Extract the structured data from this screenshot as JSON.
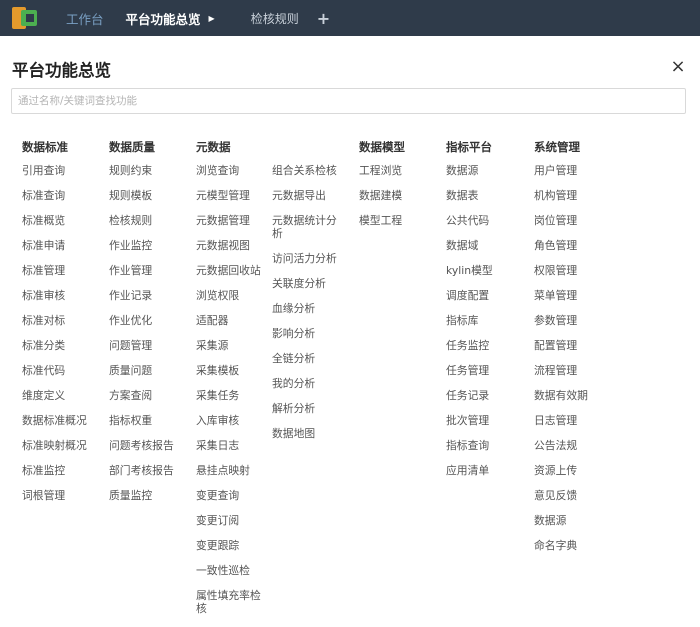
{
  "nav": {
    "home": "工作台",
    "current": "平台功能总览",
    "tab": "检核规则",
    "add": "+"
  },
  "panel": {
    "title": "平台功能总览",
    "close": "×",
    "search_placeholder": "通过名称/关键词查找功能"
  },
  "columns": [
    {
      "header": "数据标准",
      "items": [
        "引用查询",
        "标准查询",
        "标准概览",
        "标准申请",
        "标准管理",
        "标准审核",
        "标准对标",
        "标准分类",
        "标准代码",
        "维度定义",
        "数据标准概况",
        "标准映射概况",
        "标准监控",
        "词根管理"
      ]
    },
    {
      "header": "数据质量",
      "items": [
        "规则约束",
        "规则模板",
        "检核规则",
        "作业监控",
        "作业管理",
        "作业记录",
        "作业优化",
        "问题管理",
        "质量问题",
        "方案查阅",
        "指标权重",
        "问题考核报告",
        "部门考核报告",
        "质量监控"
      ]
    },
    {
      "header": "元数据",
      "items": [
        "浏览查询",
        "元模型管理",
        "元数据管理",
        "元数据视图",
        "元数据回收站",
        "浏览权限",
        "适配器",
        "采集源",
        "采集模板",
        "采集任务",
        "入库审核",
        "采集日志",
        "悬挂点映射",
        "变更查询",
        "变更订阅",
        "变更跟踪",
        "一致性巡检",
        "属性填充率检核"
      ]
    },
    {
      "header": "",
      "items": [
        "组合关系检核",
        "元数据导出",
        "元数据统计分析",
        "访问活力分析",
        "关联度分析",
        "血缘分析",
        "影响分析",
        "全链分析",
        "我的分析",
        "解析分析",
        "数据地图"
      ]
    },
    {
      "header": "数据模型",
      "items": [
        "工程浏览",
        "数据建模",
        "模型工程"
      ]
    },
    {
      "header": "指标平台",
      "items": [
        "数据源",
        "数据表",
        "公共代码",
        "数据域",
        "kylin模型",
        "调度配置",
        "指标库",
        "任务监控",
        "任务管理",
        "任务记录",
        "批次管理",
        "指标查询",
        "应用清单"
      ]
    },
    {
      "header": "系统管理",
      "items": [
        "用户管理",
        "机构管理",
        "岗位管理",
        "角色管理",
        "权限管理",
        "菜单管理",
        "参数管理",
        "配置管理",
        "流程管理",
        "数据有效期",
        "日志管理",
        "公告法规",
        "资源上传",
        "意见反馈",
        "数据源",
        "命名字典"
      ]
    }
  ]
}
